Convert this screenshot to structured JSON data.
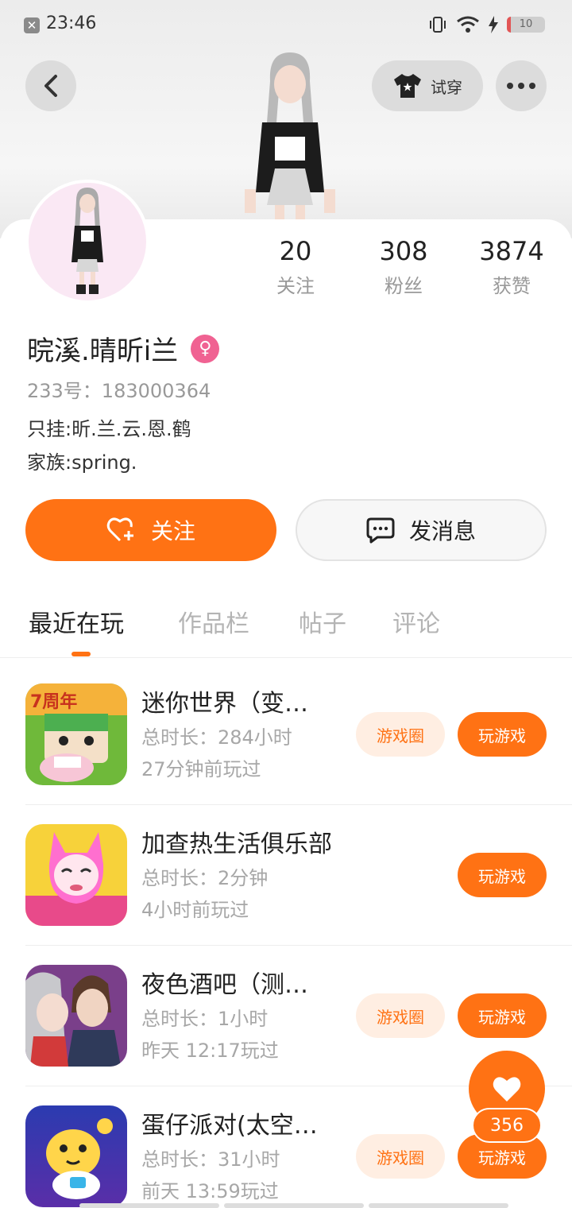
{
  "status": {
    "time": "23:46",
    "battery": "10",
    "battery_level": 0.1
  },
  "header": {
    "try_on_label": "试穿"
  },
  "profile": {
    "following": {
      "count": "20",
      "label": "关注"
    },
    "followers": {
      "count": "308",
      "label": "粉丝"
    },
    "likes": {
      "count": "3874",
      "label": "获赞"
    },
    "username": "晥溪.晴昕i兰",
    "gender": "female",
    "uid": "233号：183000364",
    "bio_line1": "只挂:昕.兰.云.恩.鹤",
    "bio_line2": "家族:spring."
  },
  "actions": {
    "follow_label": "关注",
    "message_label": "发消息"
  },
  "tabs": [
    {
      "label": "最近在玩",
      "active": true
    },
    {
      "label": "作品栏",
      "active": false
    },
    {
      "label": "帖子",
      "active": false
    },
    {
      "label": "评论",
      "active": false
    }
  ],
  "games": [
    {
      "name": "迷你世界（变…",
      "duration": "总时长：284小时",
      "last_played": "27分钟前玩过",
      "circle_label": "游戏圈",
      "play_label": "玩游戏",
      "icon": "mini-world-icon"
    },
    {
      "name": "加查热生活俱乐部",
      "duration": "总时长：2分钟",
      "last_played": "4小时前玩过",
      "circle_label": "",
      "play_label": "玩游戏",
      "icon": "gacha-club-icon"
    },
    {
      "name": "夜色酒吧（测…",
      "duration": "总时长：1小时",
      "last_played": "昨天 12:17玩过",
      "circle_label": "游戏圈",
      "play_label": "玩游戏",
      "icon": "night-bar-icon"
    },
    {
      "name": "蛋仔派对(太空…",
      "duration": "总时长：31小时",
      "last_played": "前天 13:59玩过",
      "circle_label": "游戏圈",
      "play_label": "玩游戏",
      "icon": "eggy-party-icon"
    }
  ],
  "like_fab": {
    "count": "356"
  },
  "colors": {
    "accent": "#ff7214",
    "accent_light": "#ffeee2",
    "gender_pink": "#f06292"
  }
}
